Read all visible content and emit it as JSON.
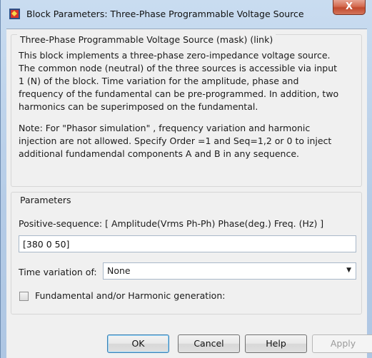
{
  "window": {
    "title": "Block Parameters: Three-Phase Programmable Voltage Source",
    "close_glyph": "X",
    "app_icon": "simulink-block-icon"
  },
  "mask_group": {
    "title": "Three-Phase Programmable Voltage Source (mask) (link)",
    "description": "This block implements a three-phase zero-impedance voltage source.\nThe common node (neutral) of the three sources is accessible via input\n1 (N) of the block. Time variation for the amplitude, phase and\nfrequency of the fundamental can be pre-programmed. In addition, two\nharmonics can be superimposed on the fundamental.",
    "note": "Note: For  \"Phasor simulation\" , frequency variation and harmonic\ninjection are not allowed.  Specify  Order =1 and Seq=1,2 or 0 to inject\nadditional fundamendal components A and B in  any sequence."
  },
  "params_group": {
    "title": "Parameters",
    "positive_sequence_label": "Positive-sequence: [ Amplitude(Vrms Ph-Ph)  Phase(deg.)   Freq. (Hz) ]",
    "positive_sequence_value": "[380 0 50]",
    "time_variation_label": "Time variation of:",
    "time_variation_value": "None",
    "harmonic_checkbox_label": "Fundamental and/or Harmonic generation:",
    "harmonic_checkbox_checked": false
  },
  "buttons": {
    "ok": "OK",
    "cancel": "Cancel",
    "help": "Help",
    "apply": "Apply"
  }
}
